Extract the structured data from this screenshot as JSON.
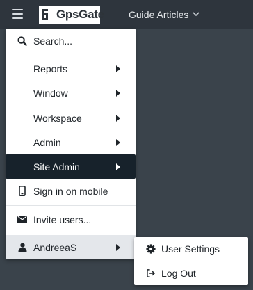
{
  "topbar": {
    "logo_text": "GpsGate",
    "nav_label": "Guide Articles"
  },
  "menu": {
    "search_label": "Search...",
    "items": [
      {
        "label": "Reports",
        "has_submenu": true
      },
      {
        "label": "Window",
        "has_submenu": true
      },
      {
        "label": "Workspace",
        "has_submenu": true
      },
      {
        "label": "Admin",
        "has_submenu": true
      },
      {
        "label": "Site Admin",
        "has_submenu": true,
        "active": true
      }
    ],
    "mobile_label": "Sign in on mobile",
    "invite_label": "Invite users...",
    "user_label": "AndreeaS"
  },
  "submenu": {
    "items": [
      {
        "label": "User Settings",
        "icon": "gear-icon"
      },
      {
        "label": "Log Out",
        "icon": "logout-icon"
      }
    ]
  },
  "colors": {
    "topbar_bg": "#2e353d",
    "page_bg": "#3a434b",
    "active_item_bg": "#17222b",
    "hover_item_bg": "#e4e7eb"
  }
}
